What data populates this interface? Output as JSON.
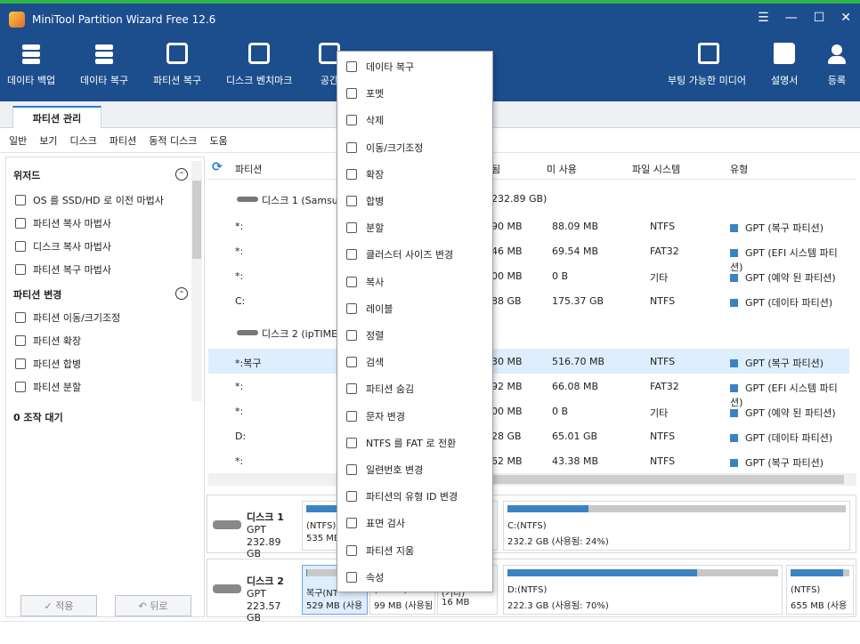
{
  "window": {
    "title": "MiniTool Partition Wizard Free 12.6",
    "controls": [
      "☰",
      "—",
      "☐",
      "✕"
    ]
  },
  "toolbar": {
    "left": [
      {
        "label": "데이타 백업",
        "icon": "data-backup-icon"
      },
      {
        "label": "데이타 복구",
        "icon": "data-recovery-icon"
      },
      {
        "label": "파티션 복구",
        "icon": "partition-recovery-icon"
      },
      {
        "label": "디스크 벤치마크",
        "icon": "disk-benchmark-icon"
      },
      {
        "label": "공간",
        "icon": "space-analyzer-icon"
      }
    ],
    "right": [
      {
        "label": "부팅 가능한 미디어",
        "icon": "bootable-media-icon"
      },
      {
        "label": "설명서",
        "icon": "manual-icon"
      },
      {
        "label": "등록",
        "icon": "register-icon"
      }
    ]
  },
  "tab": {
    "label": "파티션 관리"
  },
  "menu": [
    "일반",
    "보기",
    "디스크",
    "파티션",
    "동적 디스크",
    "도움"
  ],
  "left_panel": {
    "wizard_title": "위저드",
    "wizard_items": [
      "OS 를 SSD/HD 로 이전 마법사",
      "파티션 복사 마법사",
      "디스크 복사 마법사",
      "파티션 복구 마법사"
    ],
    "change_title": "파티션 변경",
    "change_items": [
      "파티션 이동/크기조정",
      "파티션 확장",
      "파티션 합병",
      "파티션 분할"
    ],
    "pending": "0 조작 대기",
    "apply_label": "✓ 적용",
    "undo_label": "↶ 뒤로"
  },
  "table": {
    "headers": {
      "partition": "파티션",
      "used": "됨",
      "unused": "미 사용",
      "fs": "파일 시스템",
      "type": "유형"
    },
    "disk1_label": "디스크 1 (Samsu",
    "disk1_size": "232.89 GB)",
    "disk2_label": "디스크 2 (ipTIME",
    "disk1_rows": [
      {
        "name": "*:",
        "used": "90 MB",
        "unused": "88.09 MB",
        "fs": "NTFS",
        "type": "GPT (복구 파티션)"
      },
      {
        "name": "*:",
        "used": "46 MB",
        "unused": "69.54 MB",
        "fs": "FAT32",
        "type": "GPT (EFI 시스템 파티션)"
      },
      {
        "name": "*:",
        "used": "00 MB",
        "unused": "0 B",
        "fs": "기타",
        "type": "GPT (예약 된 파티션)"
      },
      {
        "name": "C:",
        "used": "88 GB",
        "unused": "175.37 GB",
        "fs": "NTFS",
        "type": "GPT (데이타 파티션)"
      }
    ],
    "disk2_rows": [
      {
        "name": "*:복구",
        "used": "30 MB",
        "unused": "516.70 MB",
        "fs": "NTFS",
        "type": "GPT (복구 파티션)"
      },
      {
        "name": "*:",
        "used": "92 MB",
        "unused": "66.08 MB",
        "fs": "FAT32",
        "type": "GPT (EFI 시스템 파티션)"
      },
      {
        "name": "*:",
        "used": "00 MB",
        "unused": "0 B",
        "fs": "기타",
        "type": "GPT (예약 된 파티션)"
      },
      {
        "name": "D:",
        "used": "28 GB",
        "unused": "65.01 GB",
        "fs": "NTFS",
        "type": "GPT (데이타 파티션)"
      },
      {
        "name": "*:",
        "used": "62 MB",
        "unused": "43.38 MB",
        "fs": "NTFS",
        "type": "GPT (복구 파티션)"
      }
    ]
  },
  "diskmap": {
    "disk1": {
      "name": "디스크 1",
      "style": "GPT",
      "size": "232.89 GB"
    },
    "disk1_segs": [
      {
        "l1": "(NTFS)",
        "l2": "535 MB",
        "fill": 0.5
      },
      {
        "l1": "C:(NTFS)",
        "l2": "232.2 GB (사용됨: 24%)",
        "fill": 0.24
      }
    ],
    "disk2": {
      "name": "디스크 2",
      "style": "GPT",
      "size": "223.57 GB"
    },
    "disk2_segs": [
      {
        "l1": "복구(NT",
        "l2": "529 MB (사용",
        "fill": 0.02
      },
      {
        "l1": "(FAT32)",
        "l2": "99 MB (사용됨",
        "fill": 0.3
      },
      {
        "l1": "(기타)",
        "l2": "16 MB",
        "fill": 1.0
      },
      {
        "l1": "D:(NTFS)",
        "l2": "222.3 GB (사용됨: 70%)",
        "fill": 0.7
      },
      {
        "l1": "(NTFS)",
        "l2": "655 MB (사용",
        "fill": 0.9
      }
    ]
  },
  "context_menu": [
    {
      "label": "데이타 복구",
      "icon": "data-recovery-icon"
    },
    {
      "label": "포멧",
      "icon": "format-icon"
    },
    {
      "label": "삭제",
      "icon": "delete-icon"
    },
    {
      "label": "이동/크기조정",
      "icon": "resize-icon"
    },
    {
      "label": "확장",
      "icon": "extend-icon"
    },
    {
      "label": "합병",
      "icon": "merge-icon"
    },
    {
      "label": "분할",
      "icon": "split-icon"
    },
    {
      "label": "클러스터 사이즈 변경",
      "icon": "cluster-size-icon"
    },
    {
      "label": "복사",
      "icon": "copy-icon"
    },
    {
      "label": "레이블",
      "icon": "label-icon"
    },
    {
      "label": "정렬",
      "icon": "align-icon"
    },
    {
      "label": "검색",
      "icon": "search-icon"
    },
    {
      "label": "파티션 숨김",
      "icon": "hide-icon"
    },
    {
      "label": "문자 변경",
      "icon": "drive-letter-icon"
    },
    {
      "label": "NTFS 를 FAT 로 전환",
      "icon": "convert-icon"
    },
    {
      "label": "일련번호 변경",
      "icon": "serial-icon"
    },
    {
      "label": "파티션의 유형 ID 변경",
      "icon": "type-id-icon"
    },
    {
      "label": "표면 검사",
      "icon": "surface-test-icon"
    },
    {
      "label": "파티션 지움",
      "icon": "wipe-icon"
    },
    {
      "label": "속성",
      "icon": "properties-icon"
    }
  ],
  "colors": {
    "titlebar": "#1c4e8e",
    "accent": "#3b82c4",
    "selection": "#dfeefc"
  }
}
